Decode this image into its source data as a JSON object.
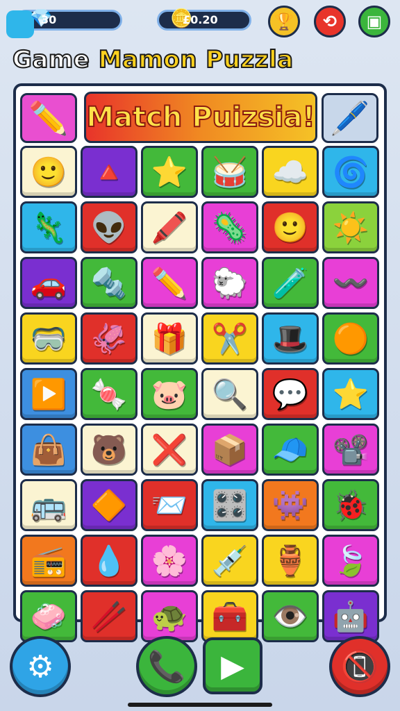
{
  "hud": {
    "gems": {
      "value": "30",
      "icon": "crystal-icon",
      "glyph": "💎"
    },
    "coins": {
      "value": "£0.20",
      "icon": "gold-nugget-icon",
      "glyph": "🪙"
    },
    "buttons": [
      {
        "name": "trophy-button",
        "glyph": "🏆",
        "color": "#f5c226"
      },
      {
        "name": "swap-button",
        "glyph": "⟲",
        "color": "#e8342a"
      },
      {
        "name": "menu-button",
        "glyph": "▣",
        "color": "#3bb53c"
      }
    ]
  },
  "title": {
    "word1": "Game",
    "word2": "Mamon Puzzla"
  },
  "board": {
    "banner": "Match Puizsia!",
    "left_tile": {
      "icon": "crossed-pencils-icon",
      "glyph": "✏️",
      "color": "#e94fd0"
    },
    "right_tile": {
      "icon": "paint-marker-icon",
      "glyph": "🖊️",
      "color": "#c8d7ea"
    }
  },
  "colors": {
    "orange": "#f2781e",
    "purple": "#7a2fd0",
    "green": "#43b93a",
    "yellow": "#f9d51f",
    "cyan": "#2fb6ea",
    "red": "#e0302a",
    "magenta": "#e83fd6",
    "cream": "#fbf4d2",
    "blue": "#3d8fe0",
    "lime": "#8bd23c"
  },
  "tiles": [
    [
      {
        "c": "cream",
        "g": "🙂",
        "n": "critter-face-icon"
      },
      {
        "c": "purple",
        "g": "🔺",
        "n": "cone-icon"
      },
      {
        "c": "green",
        "g": "⭐",
        "n": "star-icon"
      },
      {
        "c": "green",
        "g": "🥁",
        "n": "drum-icon"
      },
      {
        "c": "yellow",
        "g": "☁️",
        "n": "cloud-icon"
      },
      {
        "c": "cyan",
        "g": "🌀",
        "n": "swirl-icon"
      }
    ],
    [
      {
        "c": "cyan",
        "g": "🦎",
        "n": "lizard-icon"
      },
      {
        "c": "red",
        "g": "👽",
        "n": "alien-icon"
      },
      {
        "c": "cream",
        "g": "🖍️",
        "n": "crayon-icon"
      },
      {
        "c": "magenta",
        "g": "🦠",
        "n": "germ-icon"
      },
      {
        "c": "red",
        "g": "🙂",
        "n": "pink-face-icon"
      },
      {
        "c": "lime",
        "g": "☀️",
        "n": "sun-icon"
      }
    ],
    [
      {
        "c": "purple",
        "g": "🚗",
        "n": "car-icon"
      },
      {
        "c": "green",
        "g": "🔩",
        "n": "bolt-icon"
      },
      {
        "c": "magenta",
        "g": "✏️",
        "n": "pencil-icon"
      },
      {
        "c": "magenta",
        "g": "🐑",
        "n": "sheep-icon"
      },
      {
        "c": "green",
        "g": "🧪",
        "n": "flask-icon"
      },
      {
        "c": "magenta",
        "g": "〰️",
        "n": "wave-icon"
      }
    ],
    [
      {
        "c": "yellow",
        "g": "🥽",
        "n": "goggles-icon"
      },
      {
        "c": "red",
        "g": "🦑",
        "n": "squid-icon"
      },
      {
        "c": "cream",
        "g": "🎁",
        "n": "gift-box-icon"
      },
      {
        "c": "yellow",
        "g": "✂️",
        "n": "crossed-markers-icon"
      },
      {
        "c": "cyan",
        "g": "🎩",
        "n": "hat-icon"
      },
      {
        "c": "green",
        "g": "🟠",
        "n": "dome-icon"
      }
    ],
    [
      {
        "c": "blue",
        "g": "▶️",
        "n": "play-triangle-icon"
      },
      {
        "c": "green",
        "g": "🍬",
        "n": "candy-icon"
      },
      {
        "c": "green",
        "g": "🐷",
        "n": "pig-icon"
      },
      {
        "c": "cream",
        "g": "🔍",
        "n": "magnifier-icon"
      },
      {
        "c": "red",
        "g": "💬",
        "n": "speech-cloud-icon"
      },
      {
        "c": "cyan",
        "g": "⭐",
        "n": "orange-star-icon"
      }
    ],
    [
      {
        "c": "blue",
        "g": "👜",
        "n": "bag-icon"
      },
      {
        "c": "cream",
        "g": "🐻",
        "n": "bear-icon"
      },
      {
        "c": "cream",
        "g": "❌",
        "n": "cross-icon"
      },
      {
        "c": "magenta",
        "g": "📦",
        "n": "crate-icon"
      },
      {
        "c": "green",
        "g": "🧢",
        "n": "cap-icon"
      },
      {
        "c": "magenta",
        "g": "📽️",
        "n": "projector-icon"
      }
    ],
    [
      {
        "c": "cream",
        "g": "🚌",
        "n": "bus-icon"
      },
      {
        "c": "purple",
        "g": "🔶",
        "n": "diamond-icon"
      },
      {
        "c": "red",
        "g": "📨",
        "n": "envelope-icon"
      },
      {
        "c": "cyan",
        "g": "🎛️",
        "n": "panel-icon"
      },
      {
        "c": "orange",
        "g": "👾",
        "n": "monster-icon"
      },
      {
        "c": "green",
        "g": "🐞",
        "n": "beetle-icon"
      }
    ],
    [
      {
        "c": "orange",
        "g": "📻",
        "n": "radio-icon"
      },
      {
        "c": "red",
        "g": "💧",
        "n": "drop-icon"
      },
      {
        "c": "magenta",
        "g": "🌸",
        "n": "flower-icon"
      },
      {
        "c": "yellow",
        "g": "💉",
        "n": "syringe-icon"
      },
      {
        "c": "yellow",
        "g": "🏺",
        "n": "vase-icon"
      },
      {
        "c": "magenta",
        "g": "🍃",
        "n": "leaf-icon"
      }
    ],
    [
      {
        "c": "green",
        "g": "🧼",
        "n": "soap-icon"
      },
      {
        "c": "red",
        "g": "🥢",
        "n": "chopsticks-icon"
      },
      {
        "c": "magenta",
        "g": "🐢",
        "n": "turtle-icon"
      },
      {
        "c": "yellow",
        "g": "🧰",
        "n": "toolbox-icon"
      },
      {
        "c": "green",
        "g": "👁️",
        "n": "eye-icon"
      },
      {
        "c": "purple",
        "g": "🤖",
        "n": "robot-icon"
      }
    ]
  ],
  "bottom": {
    "settings": {
      "glyph": "⚙",
      "color": "#2fa4e6"
    },
    "call": {
      "glyph": "📞",
      "color": "#3bb53c"
    },
    "play": {
      "glyph": "▶"
    },
    "hangup": {
      "glyph": "📵",
      "color": "#e0302a"
    }
  }
}
